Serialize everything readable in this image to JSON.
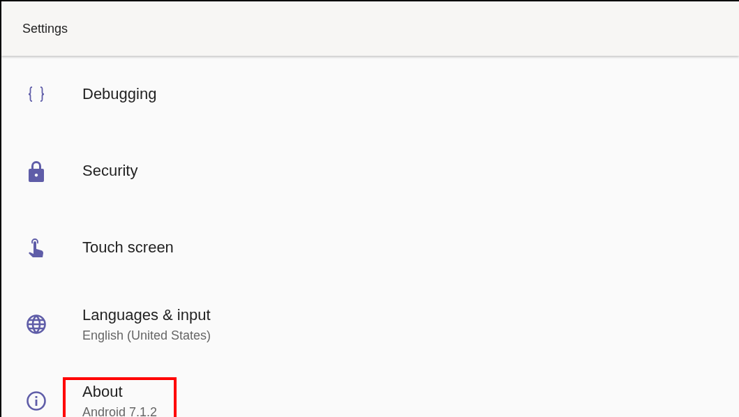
{
  "header": {
    "title": "Settings"
  },
  "items": [
    {
      "kind": "braces",
      "title": "Debugging",
      "highlighted": false
    },
    {
      "kind": "lock",
      "title": "Security",
      "highlighted": false
    },
    {
      "kind": "touch",
      "title": "Touch screen",
      "highlighted": false
    },
    {
      "kind": "globe",
      "title": "Languages & input",
      "subtitle": "English (United States)",
      "highlighted": false
    },
    {
      "kind": "info",
      "title": "About",
      "subtitle": "Android 7.1.2",
      "highlighted": true
    }
  ]
}
